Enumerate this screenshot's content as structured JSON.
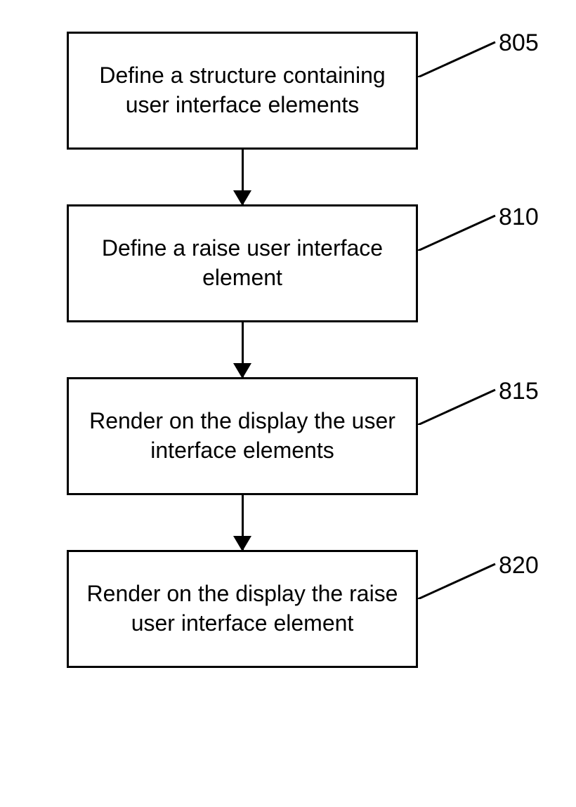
{
  "steps": [
    {
      "text": "Define a structure containing user interface elements",
      "label": "805"
    },
    {
      "text": "Define a raise user interface element",
      "label": "810"
    },
    {
      "text": "Render on the display the user interface elements",
      "label": "815"
    },
    {
      "text": "Render on the display the raise user interface element",
      "label": "820"
    }
  ]
}
